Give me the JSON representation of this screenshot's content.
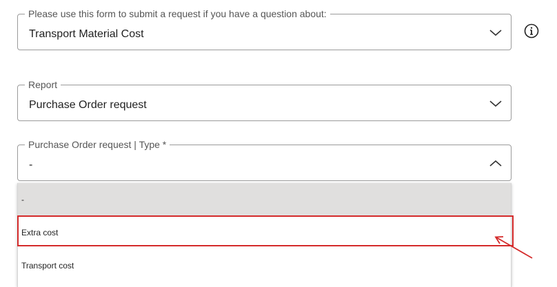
{
  "form": {
    "question_field": {
      "label": "Please use this form to submit a request if you have a question about:",
      "value": "Transport Material Cost",
      "chevron": "chevron-down-icon"
    },
    "info_icon": "info-circle-icon",
    "report_field": {
      "label": "Report",
      "value": "Purchase Order request",
      "chevron": "chevron-down-icon"
    },
    "type_field": {
      "label": "Purchase Order request | Type *",
      "value": "-",
      "chevron": "chevron-up-icon",
      "expanded": true
    },
    "type_options": [
      {
        "label": "-",
        "selected": true
      },
      {
        "label": "Extra cost",
        "selected": false,
        "annotated": true
      },
      {
        "label": "Transport cost",
        "selected": false
      }
    ]
  },
  "colors": {
    "border": "#9a9a9a",
    "selected_option_bg": "#e0dfde",
    "annotation_red": "#d42a2a"
  }
}
